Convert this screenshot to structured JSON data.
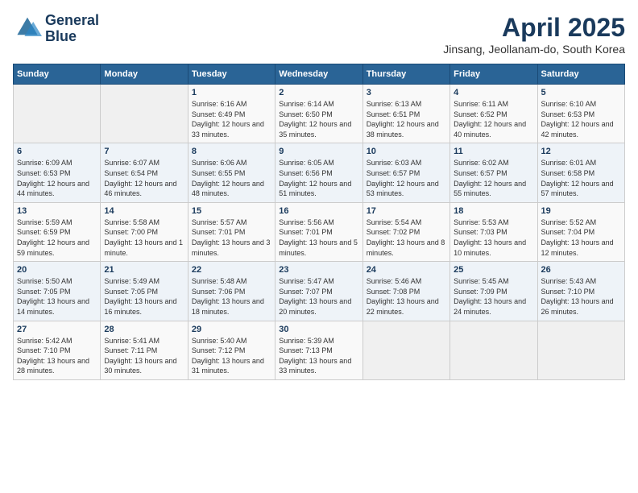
{
  "header": {
    "logo_line1": "General",
    "logo_line2": "Blue",
    "month": "April 2025",
    "location": "Jinsang, Jeollanam-do, South Korea"
  },
  "weekdays": [
    "Sunday",
    "Monday",
    "Tuesday",
    "Wednesday",
    "Thursday",
    "Friday",
    "Saturday"
  ],
  "weeks": [
    [
      {
        "day": "",
        "sunrise": "",
        "sunset": "",
        "daylight": ""
      },
      {
        "day": "",
        "sunrise": "",
        "sunset": "",
        "daylight": ""
      },
      {
        "day": "1",
        "sunrise": "Sunrise: 6:16 AM",
        "sunset": "Sunset: 6:49 PM",
        "daylight": "Daylight: 12 hours and 33 minutes."
      },
      {
        "day": "2",
        "sunrise": "Sunrise: 6:14 AM",
        "sunset": "Sunset: 6:50 PM",
        "daylight": "Daylight: 12 hours and 35 minutes."
      },
      {
        "day": "3",
        "sunrise": "Sunrise: 6:13 AM",
        "sunset": "Sunset: 6:51 PM",
        "daylight": "Daylight: 12 hours and 38 minutes."
      },
      {
        "day": "4",
        "sunrise": "Sunrise: 6:11 AM",
        "sunset": "Sunset: 6:52 PM",
        "daylight": "Daylight: 12 hours and 40 minutes."
      },
      {
        "day": "5",
        "sunrise": "Sunrise: 6:10 AM",
        "sunset": "Sunset: 6:53 PM",
        "daylight": "Daylight: 12 hours and 42 minutes."
      }
    ],
    [
      {
        "day": "6",
        "sunrise": "Sunrise: 6:09 AM",
        "sunset": "Sunset: 6:53 PM",
        "daylight": "Daylight: 12 hours and 44 minutes."
      },
      {
        "day": "7",
        "sunrise": "Sunrise: 6:07 AM",
        "sunset": "Sunset: 6:54 PM",
        "daylight": "Daylight: 12 hours and 46 minutes."
      },
      {
        "day": "8",
        "sunrise": "Sunrise: 6:06 AM",
        "sunset": "Sunset: 6:55 PM",
        "daylight": "Daylight: 12 hours and 48 minutes."
      },
      {
        "day": "9",
        "sunrise": "Sunrise: 6:05 AM",
        "sunset": "Sunset: 6:56 PM",
        "daylight": "Daylight: 12 hours and 51 minutes."
      },
      {
        "day": "10",
        "sunrise": "Sunrise: 6:03 AM",
        "sunset": "Sunset: 6:57 PM",
        "daylight": "Daylight: 12 hours and 53 minutes."
      },
      {
        "day": "11",
        "sunrise": "Sunrise: 6:02 AM",
        "sunset": "Sunset: 6:57 PM",
        "daylight": "Daylight: 12 hours and 55 minutes."
      },
      {
        "day": "12",
        "sunrise": "Sunrise: 6:01 AM",
        "sunset": "Sunset: 6:58 PM",
        "daylight": "Daylight: 12 hours and 57 minutes."
      }
    ],
    [
      {
        "day": "13",
        "sunrise": "Sunrise: 5:59 AM",
        "sunset": "Sunset: 6:59 PM",
        "daylight": "Daylight: 12 hours and 59 minutes."
      },
      {
        "day": "14",
        "sunrise": "Sunrise: 5:58 AM",
        "sunset": "Sunset: 7:00 PM",
        "daylight": "Daylight: 13 hours and 1 minute."
      },
      {
        "day": "15",
        "sunrise": "Sunrise: 5:57 AM",
        "sunset": "Sunset: 7:01 PM",
        "daylight": "Daylight: 13 hours and 3 minutes."
      },
      {
        "day": "16",
        "sunrise": "Sunrise: 5:56 AM",
        "sunset": "Sunset: 7:01 PM",
        "daylight": "Daylight: 13 hours and 5 minutes."
      },
      {
        "day": "17",
        "sunrise": "Sunrise: 5:54 AM",
        "sunset": "Sunset: 7:02 PM",
        "daylight": "Daylight: 13 hours and 8 minutes."
      },
      {
        "day": "18",
        "sunrise": "Sunrise: 5:53 AM",
        "sunset": "Sunset: 7:03 PM",
        "daylight": "Daylight: 13 hours and 10 minutes."
      },
      {
        "day": "19",
        "sunrise": "Sunrise: 5:52 AM",
        "sunset": "Sunset: 7:04 PM",
        "daylight": "Daylight: 13 hours and 12 minutes."
      }
    ],
    [
      {
        "day": "20",
        "sunrise": "Sunrise: 5:50 AM",
        "sunset": "Sunset: 7:05 PM",
        "daylight": "Daylight: 13 hours and 14 minutes."
      },
      {
        "day": "21",
        "sunrise": "Sunrise: 5:49 AM",
        "sunset": "Sunset: 7:05 PM",
        "daylight": "Daylight: 13 hours and 16 minutes."
      },
      {
        "day": "22",
        "sunrise": "Sunrise: 5:48 AM",
        "sunset": "Sunset: 7:06 PM",
        "daylight": "Daylight: 13 hours and 18 minutes."
      },
      {
        "day": "23",
        "sunrise": "Sunrise: 5:47 AM",
        "sunset": "Sunset: 7:07 PM",
        "daylight": "Daylight: 13 hours and 20 minutes."
      },
      {
        "day": "24",
        "sunrise": "Sunrise: 5:46 AM",
        "sunset": "Sunset: 7:08 PM",
        "daylight": "Daylight: 13 hours and 22 minutes."
      },
      {
        "day": "25",
        "sunrise": "Sunrise: 5:45 AM",
        "sunset": "Sunset: 7:09 PM",
        "daylight": "Daylight: 13 hours and 24 minutes."
      },
      {
        "day": "26",
        "sunrise": "Sunrise: 5:43 AM",
        "sunset": "Sunset: 7:10 PM",
        "daylight": "Daylight: 13 hours and 26 minutes."
      }
    ],
    [
      {
        "day": "27",
        "sunrise": "Sunrise: 5:42 AM",
        "sunset": "Sunset: 7:10 PM",
        "daylight": "Daylight: 13 hours and 28 minutes."
      },
      {
        "day": "28",
        "sunrise": "Sunrise: 5:41 AM",
        "sunset": "Sunset: 7:11 PM",
        "daylight": "Daylight: 13 hours and 30 minutes."
      },
      {
        "day": "29",
        "sunrise": "Sunrise: 5:40 AM",
        "sunset": "Sunset: 7:12 PM",
        "daylight": "Daylight: 13 hours and 31 minutes."
      },
      {
        "day": "30",
        "sunrise": "Sunrise: 5:39 AM",
        "sunset": "Sunset: 7:13 PM",
        "daylight": "Daylight: 13 hours and 33 minutes."
      },
      {
        "day": "",
        "sunrise": "",
        "sunset": "",
        "daylight": ""
      },
      {
        "day": "",
        "sunrise": "",
        "sunset": "",
        "daylight": ""
      },
      {
        "day": "",
        "sunrise": "",
        "sunset": "",
        "daylight": ""
      }
    ]
  ]
}
